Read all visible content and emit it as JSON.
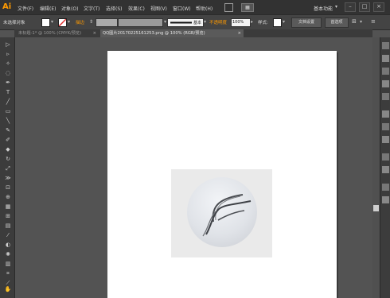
{
  "app": {
    "logo": "Ai",
    "menus": [
      "文件(F)",
      "编辑(E)",
      "对象(O)",
      "文字(T)",
      "选择(S)",
      "效果(C)",
      "视图(V)",
      "窗口(W)",
      "帮助(H)"
    ],
    "workspace": "基本功能"
  },
  "control_bar": {
    "selection_status": "未选择对象",
    "stroke_label": "描边",
    "brush_label": "基本",
    "opacity_label": "不透明度",
    "opacity_value": "100%",
    "style_label": "样式:",
    "doc_setup_button": "文档设置",
    "preferences_button": "首选项"
  },
  "tabs": [
    {
      "label": "未标题-1* @ 100% (CMYK/预览)",
      "active": false
    },
    {
      "label": "QQ图片20170225161253.png @ 100% (RGB/预览)",
      "active": true
    }
  ],
  "colors": {
    "accent": "#ff9a00",
    "canvas_bg": "#535353",
    "artboard": "#ffffff",
    "stroke_swatch_none": "#e03030"
  },
  "icons": {
    "tools": [
      "selection-tool-icon",
      "direct-select-icon",
      "magic-wand-icon",
      "lasso-icon",
      "pen-tool-icon",
      "type-tool-icon",
      "line-tool-icon",
      "rectangle-tool-icon",
      "paintbrush-icon",
      "pencil-icon",
      "blob-brush-icon",
      "eraser-icon",
      "rotate-icon",
      "scale-icon",
      "width-tool-icon",
      "free-transform-icon",
      "shape-builder-icon",
      "perspective-grid-icon",
      "mesh-icon",
      "gradient-icon",
      "eyedropper-icon",
      "blend-icon",
      "symbol-sprayer-icon",
      "column-graph-icon",
      "artboard-tool-icon",
      "slice-tool-icon",
      "hand-tool-icon",
      "zoom-tool-icon"
    ],
    "right_panel": [
      "color-panel-icon",
      "color-guide-icon",
      "swatches-icon",
      "brushes-icon",
      "symbols-icon",
      "stroke-panel-icon",
      "gradient-panel-icon",
      "transparency-icon",
      "appearance-icon",
      "graphic-styles-icon",
      "layers-icon",
      "artboards-panel-icon"
    ]
  }
}
